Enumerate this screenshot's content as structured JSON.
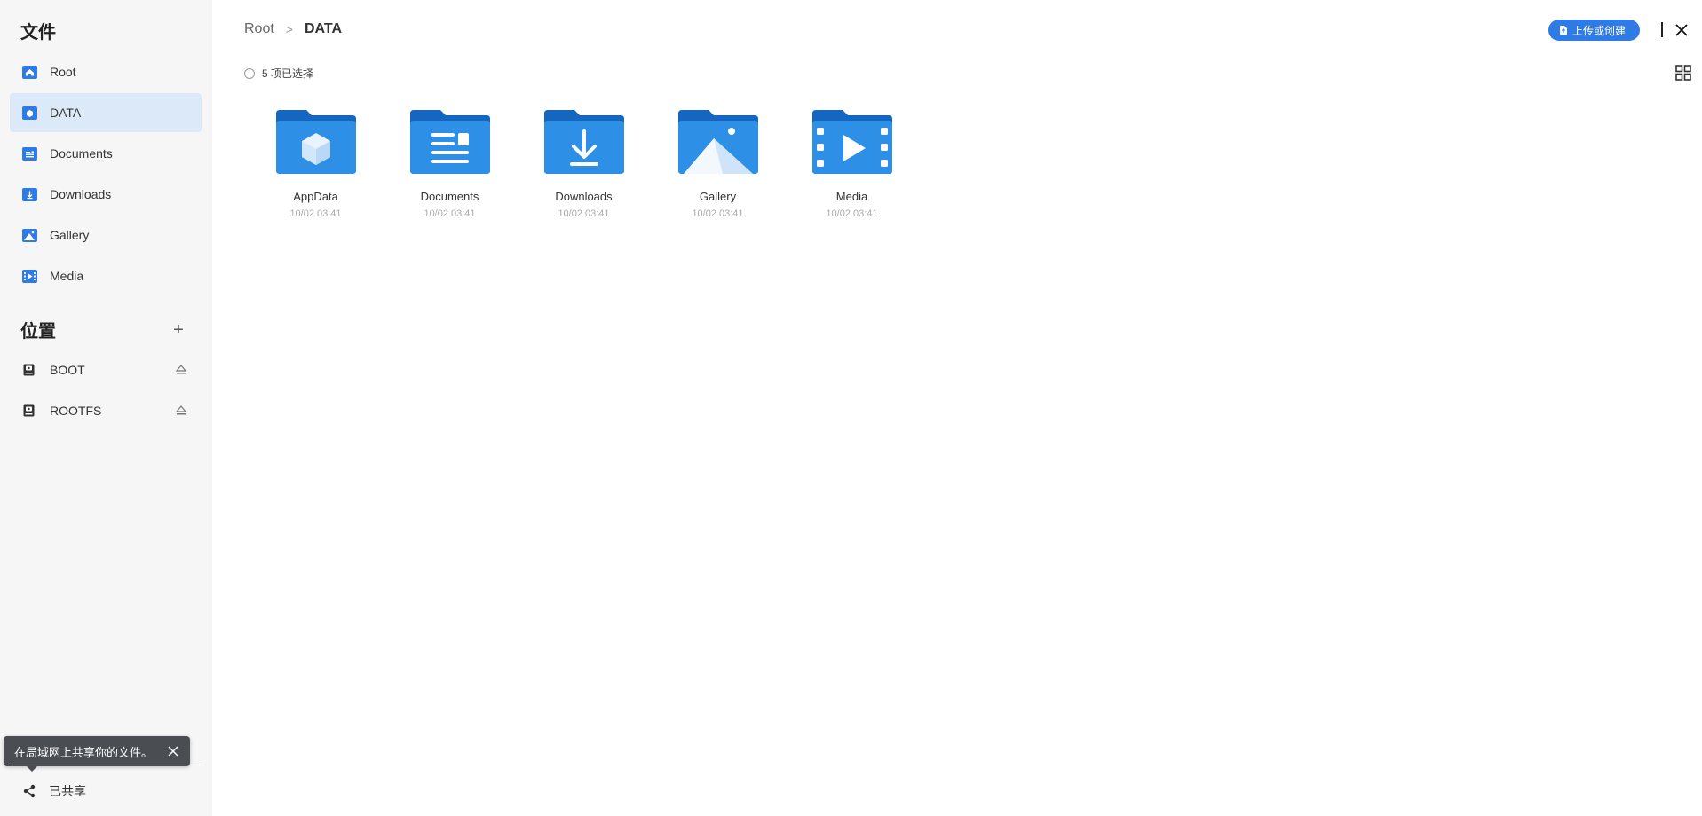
{
  "sidebar": {
    "files_title": "文件",
    "files": [
      {
        "label": "Root",
        "icon": "home-icon"
      },
      {
        "label": "DATA",
        "icon": "data-icon",
        "active": true
      },
      {
        "label": "Documents",
        "icon": "documents-icon"
      },
      {
        "label": "Downloads",
        "icon": "downloads-icon"
      },
      {
        "label": "Gallery",
        "icon": "gallery-icon"
      },
      {
        "label": "Media",
        "icon": "media-icon"
      }
    ],
    "places_title": "位置",
    "add_symbol": "+",
    "places": [
      {
        "label": "BOOT",
        "icon": "drive-icon"
      },
      {
        "label": "ROOTFS",
        "icon": "drive-icon"
      }
    ],
    "shared_label": "已共享",
    "toast_text": "在局域网上共享你的文件。"
  },
  "header": {
    "breadcrumb_root": "Root",
    "breadcrumb_sep": ">",
    "breadcrumb_current": "DATA",
    "upload_label": "上传或创建"
  },
  "toolbar": {
    "selection_text": "5 项已选择"
  },
  "folders": [
    {
      "name": "AppData",
      "date": "10/02 03:41",
      "icon": "appdata-folder-icon"
    },
    {
      "name": "Documents",
      "date": "10/02 03:41",
      "icon": "documents-folder-icon"
    },
    {
      "name": "Downloads",
      "date": "10/02 03:41",
      "icon": "downloads-folder-icon"
    },
    {
      "name": "Gallery",
      "date": "10/02 03:41",
      "icon": "gallery-folder-icon"
    },
    {
      "name": "Media",
      "date": "10/02 03:41",
      "icon": "media-folder-icon"
    }
  ],
  "colors": {
    "accent": "#2f7be5",
    "active_bg": "#dce9f8",
    "sidebar_bg": "#f6f6f7",
    "folder_dark": "#1566c0",
    "folder_light": "#2e8fe6"
  }
}
